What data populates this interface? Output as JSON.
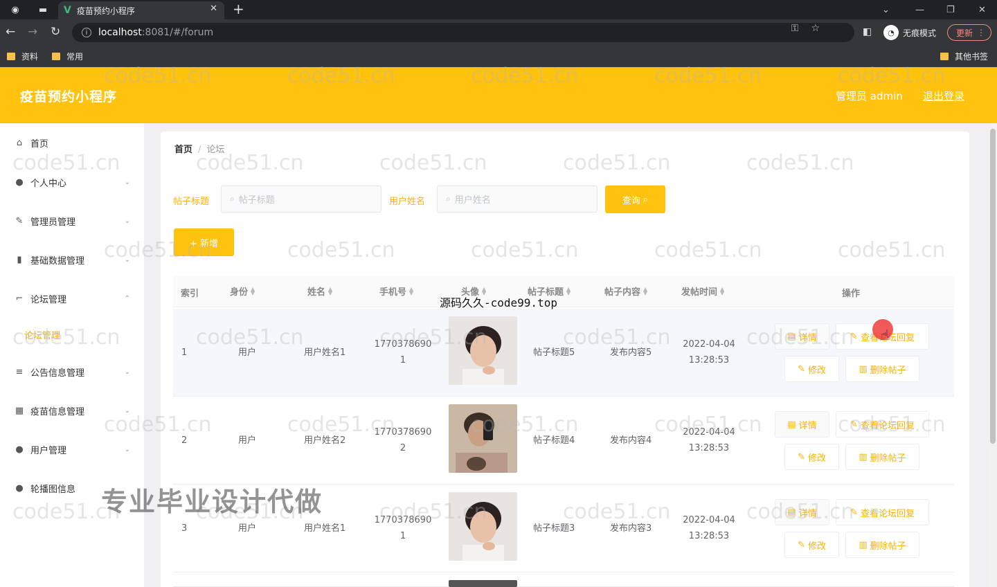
{
  "browser": {
    "tab_title": "疫苗预约小程序",
    "url_host": "localhost",
    "url_path": ":8081/#/forum",
    "incognito_label": "无痕模式",
    "update_label": "更新",
    "bookmarks": [
      "资料",
      "常用"
    ],
    "other_bookmarks": "其他书签"
  },
  "app": {
    "title": "疫苗预约小程序",
    "user_label": "管理员 admin",
    "logout_label": "退出登录"
  },
  "sidebar": {
    "items": [
      {
        "label": "首页"
      },
      {
        "label": "个人中心"
      },
      {
        "label": "管理员管理"
      },
      {
        "label": "基础数据管理"
      },
      {
        "label": "论坛管理"
      },
      {
        "label": "公告信息管理"
      },
      {
        "label": "疫苗信息管理"
      },
      {
        "label": "用户管理"
      },
      {
        "label": "轮播图信息"
      }
    ],
    "sub_active": "论坛管理"
  },
  "breadcrumb": {
    "home": "首页",
    "current": "论坛"
  },
  "filters": {
    "title_label": "帖子标题",
    "title_placeholder": "帖子标题",
    "user_label": "用户姓名",
    "user_placeholder": "用户姓名",
    "query_label": "查询",
    "add_label": "+ 新增"
  },
  "table": {
    "headers": [
      "索引",
      "身份",
      "姓名",
      "手机号",
      "头像",
      "帖子标题",
      "帖子内容",
      "发帖时间",
      "操作"
    ],
    "rows": [
      {
        "index": "1",
        "role": "用户",
        "name": "用户姓名1",
        "phone_a": "1770378690",
        "phone_b": "1",
        "title": "帖子标题5",
        "content": "发布内容5",
        "date": "2022-04-04",
        "time": "13:28:53"
      },
      {
        "index": "2",
        "role": "用户",
        "name": "用户姓名2",
        "phone_a": "1770378690",
        "phone_b": "2",
        "title": "帖子标题4",
        "content": "发布内容4",
        "date": "2022-04-04",
        "time": "13:28:53"
      },
      {
        "index": "3",
        "role": "用户",
        "name": "用户姓名1",
        "phone_a": "1770378690",
        "phone_b": "1",
        "title": "帖子标题3",
        "content": "发布内容3",
        "date": "2022-04-04",
        "time": "13:28:53"
      }
    ],
    "actions": {
      "detail": "详情",
      "view_replies": "查看论坛回复",
      "edit": "修改",
      "delete": "删除帖子"
    }
  },
  "overlays": {
    "source_text": "源码久久-code99.top",
    "promo_text": "专业毕业设计代做",
    "watermark": "code51.cn"
  },
  "colors": {
    "accent": "#ffc20e",
    "accent_text": "#ffb100",
    "chrome": "#202124"
  }
}
